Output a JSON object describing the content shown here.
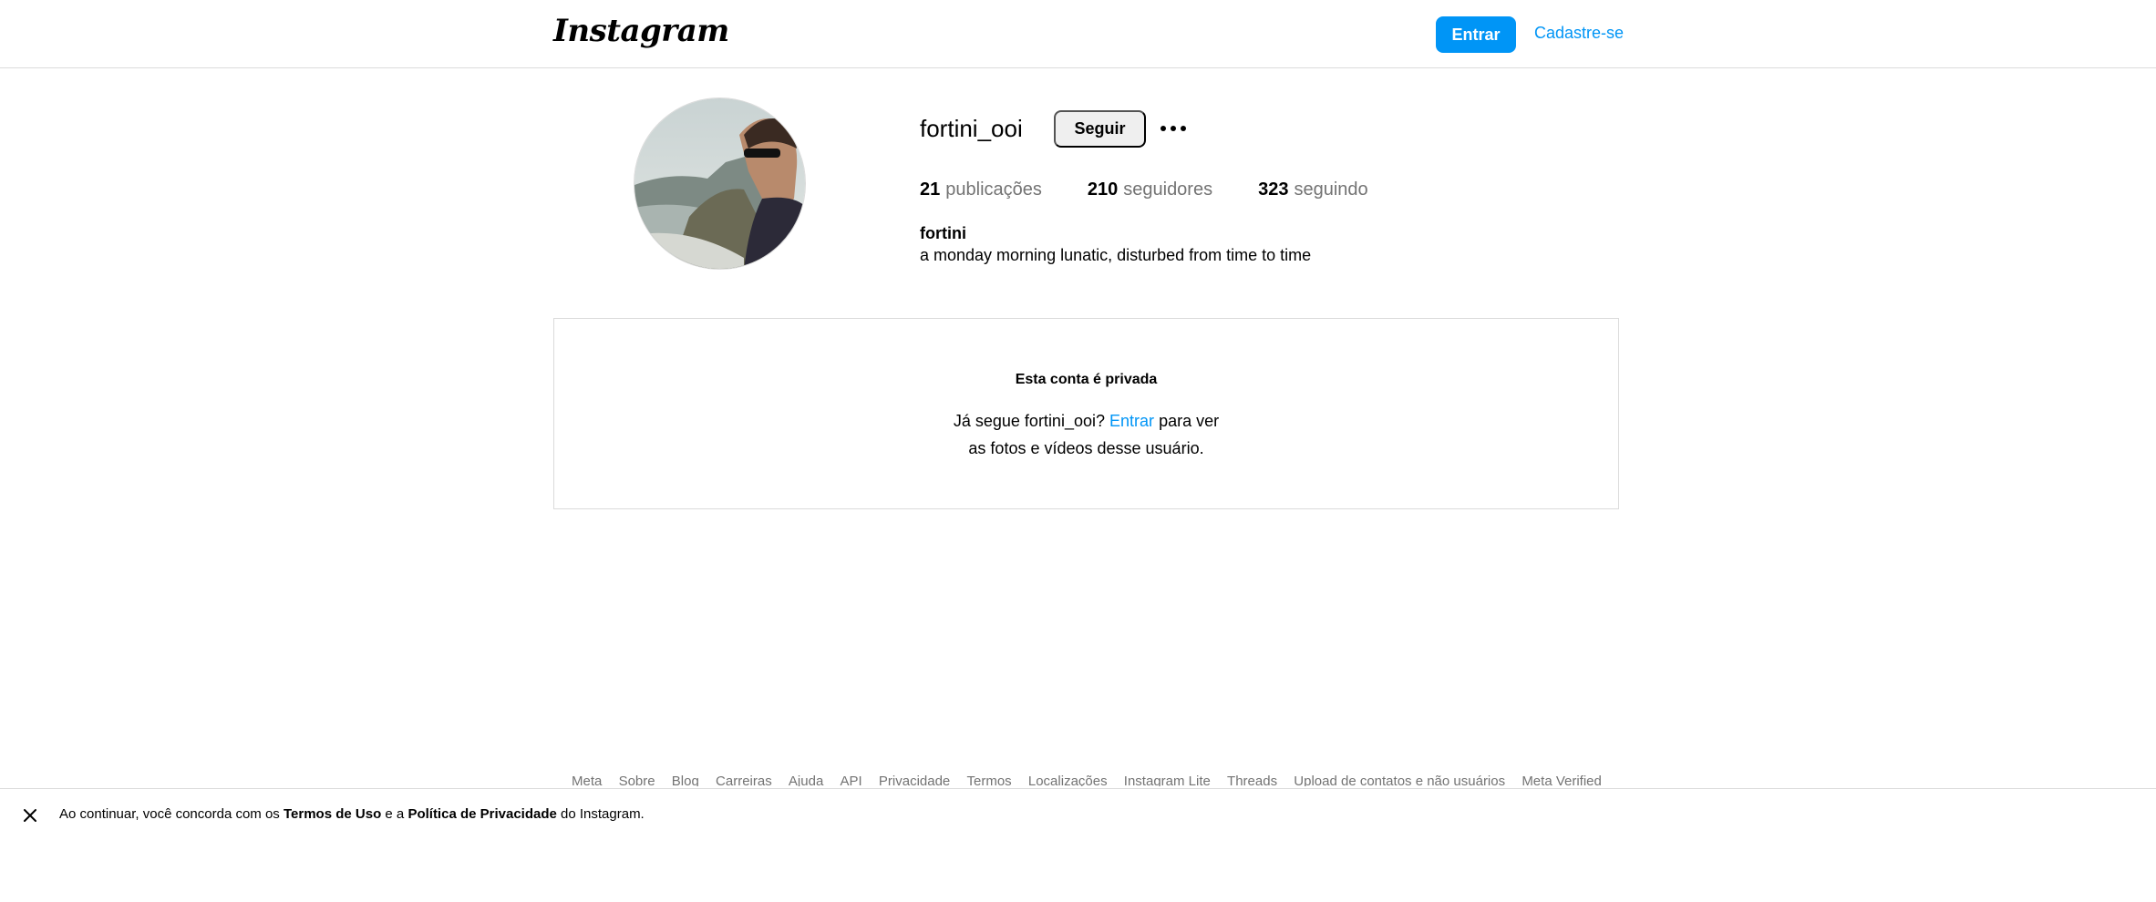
{
  "header": {
    "logo_text": "Instagram",
    "login_label": "Entrar",
    "signup_label": "Cadastre-se"
  },
  "profile": {
    "username": "fortini_ooi",
    "follow_label": "Seguir",
    "stats": [
      {
        "count": "21",
        "label": "publicações"
      },
      {
        "count": "210",
        "label": "seguidores"
      },
      {
        "count": "323",
        "label": "seguindo"
      }
    ],
    "full_name": "fortini",
    "bio": "a monday morning lunatic, disturbed from time to time"
  },
  "private": {
    "title": "Esta conta é privada",
    "line1_prefix": "Já segue fortini_ooi?",
    "line1_link": "Entrar",
    "line1_suffix": "para ver",
    "line2": "as fotos e vídeos desse usuário."
  },
  "footer": {
    "links": [
      "Meta",
      "Sobre",
      "Blog",
      "Carreiras",
      "Ajuda",
      "API",
      "Privacidade",
      "Termos",
      "Localizações",
      "Instagram Lite",
      "Threads",
      "Upload de contatos e não usuários",
      "Meta Verified"
    ]
  },
  "terms_bar": {
    "prefix": "Ao continuar, você concorda com os",
    "terms_link": "Termos de Uso",
    "middle": "e a",
    "privacy_link": "Política de Privacidade",
    "suffix": "do Instagram."
  },
  "colors": {
    "accent": "#0095f6",
    "muted": "#737373",
    "border": "#dbdbdb",
    "button_gray": "#efefef"
  }
}
